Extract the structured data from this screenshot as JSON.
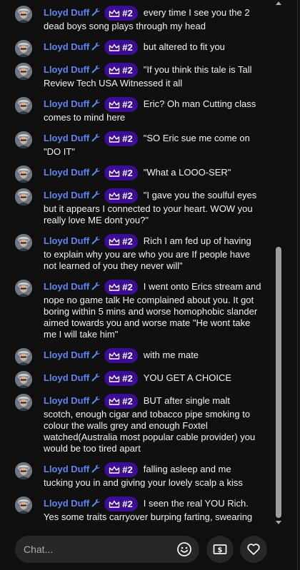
{
  "chat": {
    "input_placeholder": "Chat...",
    "messages": [
      {
        "author": "Lloyd Duff",
        "badge": "#2",
        "text": "every time I see you the 2 dead boys song plays through my head"
      },
      {
        "author": "Lloyd Duff",
        "badge": "#2",
        "text": "but altered to fit you"
      },
      {
        "author": "Lloyd Duff",
        "badge": "#2",
        "text": "\"If you think this tale is Tall Review Tech USA Witnessed it all"
      },
      {
        "author": "Lloyd Duff",
        "badge": "#2",
        "text": "Eric? Oh man Cutting class comes to mind here"
      },
      {
        "author": "Lloyd Duff",
        "badge": "#2",
        "text": "\"SO Eric sue me come on \"DO IT\""
      },
      {
        "author": "Lloyd Duff",
        "badge": "#2",
        "text": "\"What a LOOO-SER\""
      },
      {
        "author": "Lloyd Duff",
        "badge": "#2",
        "text": "\"I gave you the soulful eyes but it appears I connected to your heart. WOW you really love ME dont you?\""
      },
      {
        "author": "Lloyd Duff",
        "badge": "#2",
        "text": "Rich I am fed up of having to explain why you are who you are If people have not learned of you they never will\""
      },
      {
        "author": "Lloyd Duff",
        "badge": "#2",
        "text": "I went onto Erics stream and nope no game talk He complained about you. It got boring within 5 mins and worse homophobic slander aimed towards you and worse mate \"He wont take me I will take him\""
      },
      {
        "author": "Lloyd Duff",
        "badge": "#2",
        "text": "with me mate"
      },
      {
        "author": "Lloyd Duff",
        "badge": "#2",
        "text": "YOU GET A CHOICE"
      },
      {
        "author": "Lloyd Duff",
        "badge": "#2",
        "text": "BUT after single malt scotch, enough cigar and tobacco pipe smoking to colour the walls grey and enough Foxtel watched(Australia most popular cable provider) you would be too tired apart"
      },
      {
        "author": "Lloyd Duff",
        "badge": "#2",
        "text": "falling asleep and me tucking you in and giving your lovely scalp a kiss"
      },
      {
        "author": "Lloyd Duff",
        "badge": "#2",
        "text": "I seen the real YOU Rich. Yes some traits carryover burping farting, swearing"
      }
    ]
  },
  "icons": {
    "author_badge": "wrench-icon",
    "member_badge": "crown-icon",
    "emoji": "smiley-icon",
    "superchat": "dollar-bill-icon",
    "like": "heart-icon"
  },
  "colors": {
    "background": "#0f0f0f",
    "author": "#5e84f1",
    "badge": "#3d0d97",
    "input": "#272727"
  }
}
